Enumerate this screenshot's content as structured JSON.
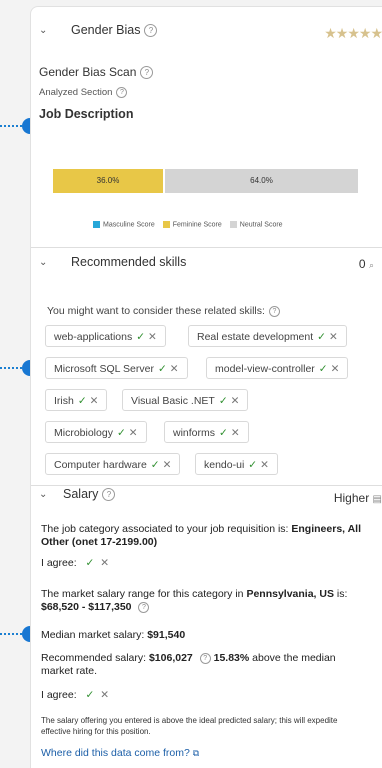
{
  "gender": {
    "title": "Gender Bias",
    "rating_stars": "★★★★★",
    "scan_label": "Gender Bias Scan",
    "analyzed_label": "Analyzed Section",
    "section": "Job Description",
    "chart_data": {
      "type": "bar",
      "categories": [
        "Feminine Score",
        "Neutral Score"
      ],
      "values": [
        36.0,
        64.0
      ],
      "labels": [
        "36.0%",
        "64.0%"
      ],
      "legend": [
        "Masculine Score",
        "Feminine Score",
        "Neutral Score"
      ],
      "colors": {
        "masculine": "#27a7d8",
        "feminine": "#e8c747",
        "neutral": "#d4d4d4"
      }
    }
  },
  "skills": {
    "title": "Recommended skills",
    "count": "0",
    "intro": "You might want to consider these related skills:",
    "items": [
      "web-applications",
      "Real estate development",
      "Microsoft SQL Server",
      "model-view-controller",
      "Irish",
      "Visual Basic .NET",
      "Microbiology",
      "winforms",
      "Computer hardware",
      "kendo-ui"
    ],
    "accept_glyph": "✓",
    "reject_glyph": "✕"
  },
  "salary": {
    "title": "Salary",
    "status": "Higher",
    "category_text": "The job category associated to your job requisition is:",
    "category_value": "Engineers, All Other (onet 17-2199.00)",
    "agree1": "I agree:",
    "range_text_a": "The market salary range for this category in",
    "range_location": "Pennsylvania, US",
    "range_text_b": "is:",
    "range_value": "$68,520 - $117,350",
    "median_label": "Median market salary:",
    "median_value": "$91,540",
    "rec_label": "Recommended salary:",
    "rec_value": "$106,027",
    "rec_pct": "15.83%",
    "rec_suffix": "above the median market rate.",
    "agree2": "I agree:",
    "note": "The salary offering you entered is above the ideal predicted salary; this will expedite effective hiring for this position.",
    "link": "Where did this data come from?"
  }
}
